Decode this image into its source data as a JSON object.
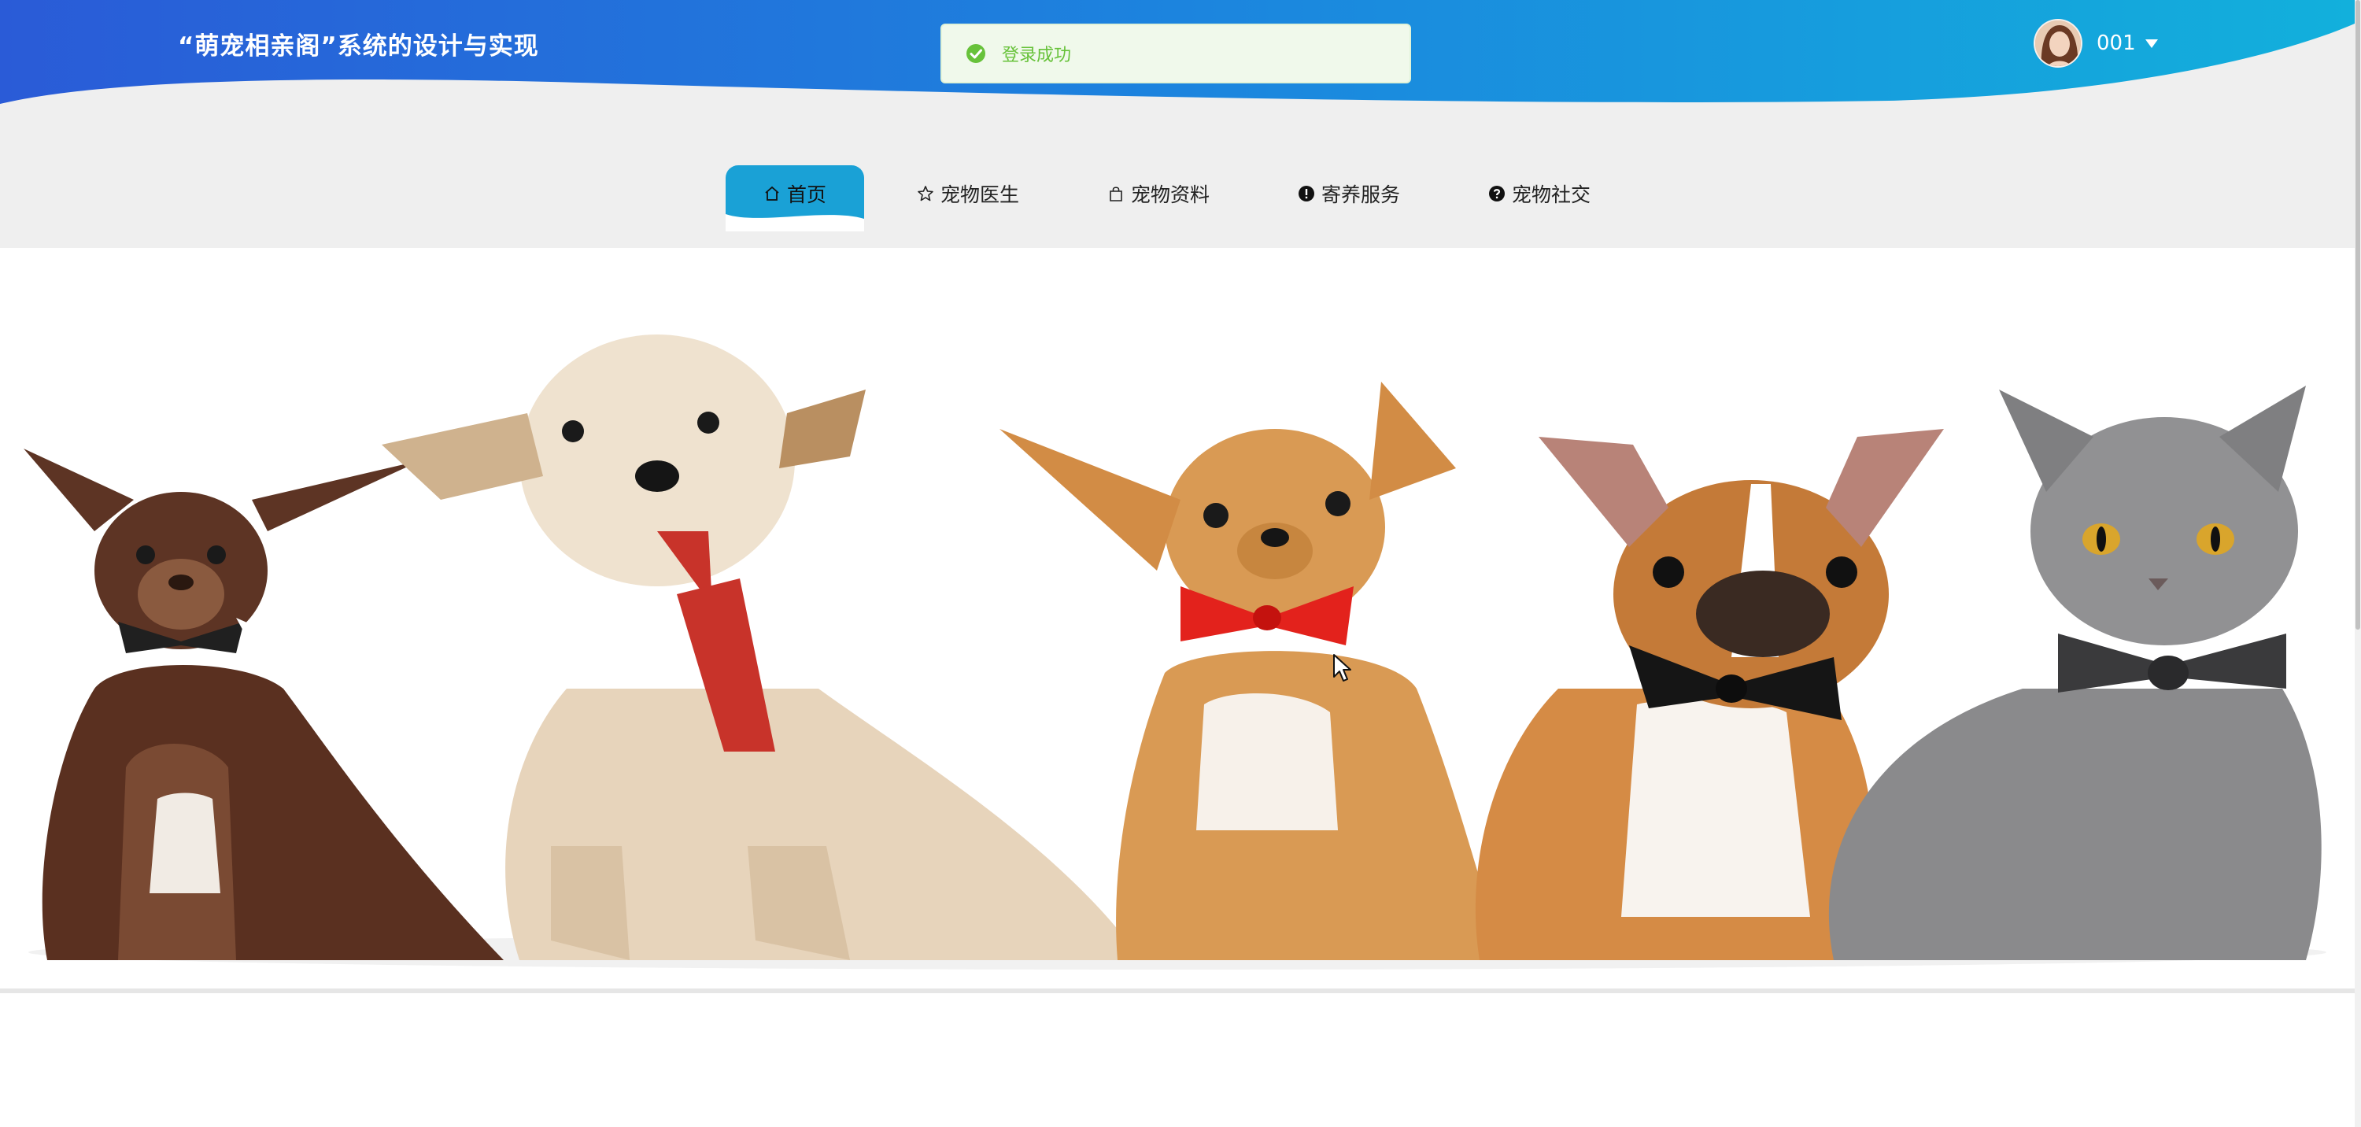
{
  "header": {
    "title": "“萌宠相亲阁”系统的设计与实现",
    "username": "001",
    "gradient_start": "#2a5bd7",
    "gradient_end": "#12b0dc"
  },
  "toast": {
    "message": "登录成功",
    "icon": "check-circle-icon",
    "color": "#67c23a"
  },
  "nav": {
    "active_color": "#1aa1d6",
    "items": [
      {
        "label": "首页",
        "icon": "home-icon",
        "active": true
      },
      {
        "label": "宠物医生",
        "icon": "star-icon",
        "active": false
      },
      {
        "label": "宠物资料",
        "icon": "bag-icon",
        "active": false
      },
      {
        "label": "寄养服务",
        "icon": "exclamation-circle-icon",
        "active": false
      },
      {
        "label": "宠物社交",
        "icon": "question-circle-icon",
        "active": false
      }
    ]
  },
  "banner": {
    "subjects": [
      "chihuahua-brown",
      "terrier-with-red-tie",
      "chihuahua-with-red-bowtie",
      "french-bulldog-with-black-bowtie",
      "gray-cat-with-black-bowtie"
    ]
  }
}
